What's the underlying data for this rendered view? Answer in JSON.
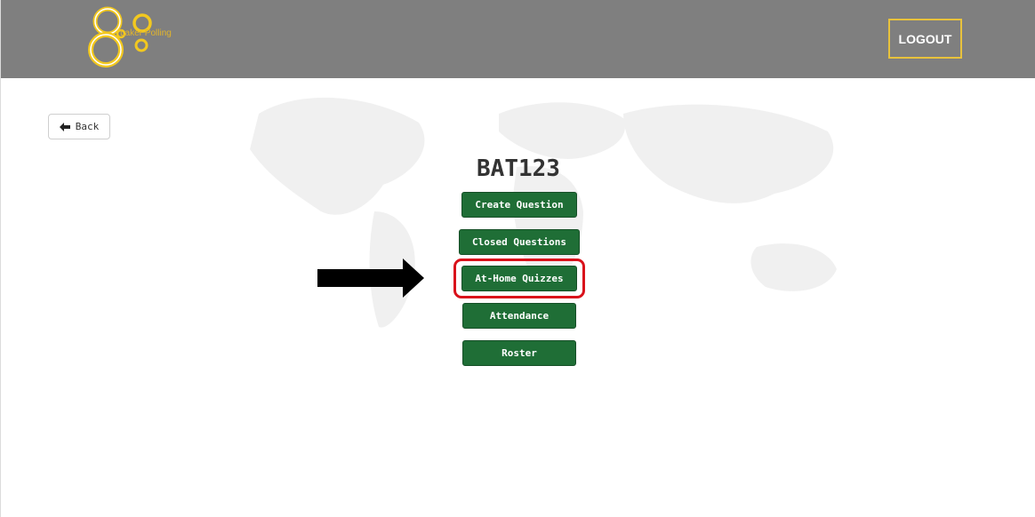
{
  "header": {
    "brand": "Laker Polling",
    "logout_label": "LOGOUT"
  },
  "nav": {
    "back_label": "Back"
  },
  "course": {
    "title": "BAT123"
  },
  "actions": {
    "create_question": "Create Question",
    "closed_questions": "Closed Questions",
    "at_home_quizzes": "At-Home Quizzes",
    "attendance": "Attendance",
    "roster": "Roster"
  },
  "colors": {
    "header_bg": "#7f7f7f",
    "brand_yellow": "#e8c23c",
    "button_green": "#1f6e36",
    "highlight_red": "#d9121b"
  },
  "icons": {
    "back": "arrow-left-icon",
    "logo": "laker-polling-logo",
    "annotation": "pointer-arrow-icon"
  }
}
